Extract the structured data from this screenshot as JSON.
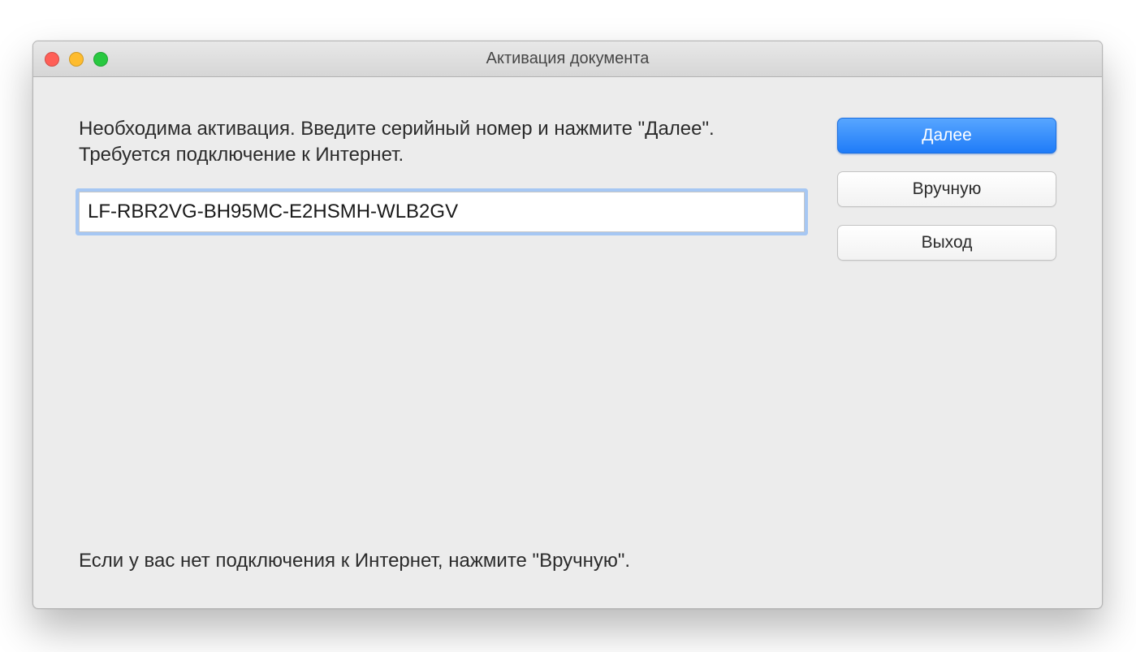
{
  "title": "Активация документа",
  "main": {
    "instruction": "Необходима активация. Введите серийный номер и нажмите \"Далее\". Требуется подключение к Интернет.",
    "serial_value": "LF-RBR2VG-BH95MC-E2HSMH-WLB2GV",
    "hint": "Если у вас нет подключения к Интернет, нажмите \"Вручную\"."
  },
  "buttons": {
    "next": "Далее",
    "manual": "Вручную",
    "exit": "Выход"
  }
}
